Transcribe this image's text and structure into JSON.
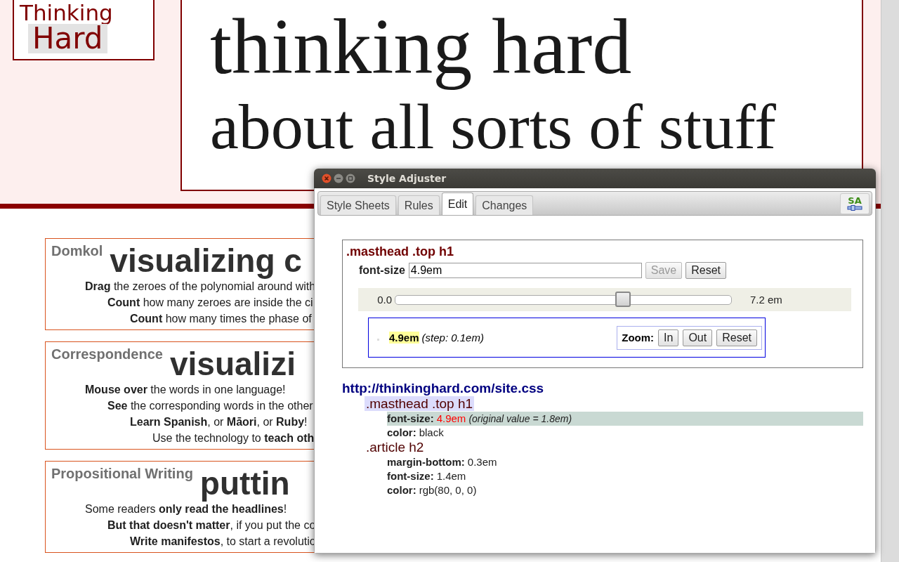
{
  "masthead": {
    "logo": {
      "line_1": "Thinking",
      "line_2": "Hard"
    },
    "title_lines": [
      "thinking hard",
      "about all sorts of stuff"
    ]
  },
  "articles": [
    {
      "label": "Domkol",
      "headline": "visualizing c",
      "lines": [
        "**Drag** the zeroes of the polynomial around with",
        "**Count** how many zeroes are inside the ci",
        "**Count** how many times the phase of"
      ]
    },
    {
      "label": "Correspondence",
      "headline": "visualizi",
      "lines": [
        "**Mouse over** the words in one language!",
        "**See** the corresponding words in the other",
        "**Learn Spanish**, or **Māori**, or **Ruby**!",
        "Use the technology to **teach oth**"
      ]
    },
    {
      "label": "Propositional Writing",
      "headline": "puttin",
      "lines": [
        "Some readers **only read the headlines**!",
        "**But that doesn't matter**, if you put the co",
        "**Write manifestos**, to start a revolutio"
      ]
    }
  ],
  "window": {
    "title": "Style Adjuster",
    "tabs": [
      {
        "label": "Style Sheets",
        "selected": false
      },
      {
        "label": "Rules",
        "selected": false
      },
      {
        "label": "Edit",
        "selected": true
      },
      {
        "label": "Changes",
        "selected": false
      }
    ],
    "toolbar_badge": "SA",
    "rule_editor": {
      "selector": ".masthead .top h1",
      "property_label": "font-size",
      "value": "4.9em",
      "save_label": "Save",
      "save_disabled": true,
      "reset_label": "Reset",
      "slider": {
        "min_label": "0.0",
        "max_label": "7.2 em",
        "level": 0.68
      },
      "preview": {
        "value": "4.9em",
        "step_note": "(step: 0.1em)"
      },
      "zoom": {
        "label": "Zoom:",
        "buttons": [
          "In",
          "Out",
          "Reset"
        ]
      }
    },
    "stylesheet": {
      "url": "http://thinkinghard.com/site.css",
      "rules": [
        {
          "selector": ".masthead .top h1",
          "selected": true,
          "properties": [
            {
              "name": "font-size:",
              "value": "4.9em",
              "modified": true,
              "original_note": "(original value = 1.8em)"
            },
            {
              "name": "color:",
              "value": "black",
              "modified": false
            }
          ]
        },
        {
          "selector": ".article h2",
          "selected": false,
          "properties": [
            {
              "name": "margin-bottom:",
              "value": "0.3em",
              "modified": false
            },
            {
              "name": "font-size:",
              "value": "1.4em",
              "modified": false
            },
            {
              "name": "color:",
              "value": "rgb(80, 0, 0)",
              "modified": false
            }
          ]
        }
      ]
    }
  }
}
